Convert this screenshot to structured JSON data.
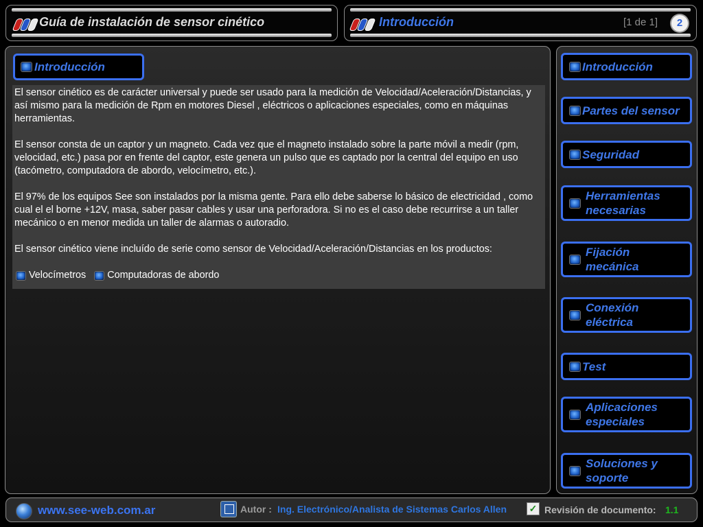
{
  "header": {
    "title": "Guía de instalación de sensor cinético",
    "section_title": "Introducción",
    "pager": "[1 de 1]",
    "page_number": "2"
  },
  "section_button": "Introducción",
  "content": {
    "paragraphs": [
      "El sensor cinético es  de carácter universal y puede ser usado para la medición de Velocidad/Aceleración/Distancias, y así mismo para la medición de Rpm en motores Diesel , eléctricos o aplicaciones especiales, como en máquinas herramientas.",
      "El sensor consta de un captor y un magneto. Cada vez que el magneto instalado sobre la parte móvil a medir (rpm, velocidad, etc.)  pasa por en frente del captor, este genera un pulso que es captado por la central del equipo en uso (tacómetro, computadora de abordo, velocímetro, etc.).",
      "El 97% de los equipos See son instalados por la misma gente. Para ello debe saberse lo básico de electricidad , como cual el el borne +12V, masa, saber pasar cables y usar una perforadora. Si no es el caso debe recurrirse a un taller mecánico o en menor medida un taller de alarmas o autoradio.",
      "El sensor cinético viene incluído de serie como sensor de Velocidad/Aceleración/Distancias en los productos:"
    ],
    "products": [
      "Velocímetros",
      "Computadoras de abordo"
    ]
  },
  "nav": {
    "items": [
      {
        "label": "Introducción"
      },
      {
        "label": "Partes del sensor"
      },
      {
        "label": "Seguridad"
      },
      {
        "label": "Herramientas necesarias"
      },
      {
        "label": "Fijación mecánica"
      },
      {
        "label": "Conexión eléctrica"
      },
      {
        "label": "Test"
      },
      {
        "label": "Aplicaciones especiales"
      },
      {
        "label": "Soluciones y soporte"
      }
    ]
  },
  "footer": {
    "website": "www.see-web.com.ar",
    "author_label": "Autor :",
    "author": "Ing. Electrónico/Analista de Sistemas Carlos Allen",
    "revision_label": "Revisión de documento:",
    "revision": "1.1"
  },
  "colors": {
    "accent_blue": "#3b6ff0",
    "text_blue": "#3f77e8",
    "revision_green": "#1eb81e",
    "content_bg": "#3d3d3d"
  }
}
